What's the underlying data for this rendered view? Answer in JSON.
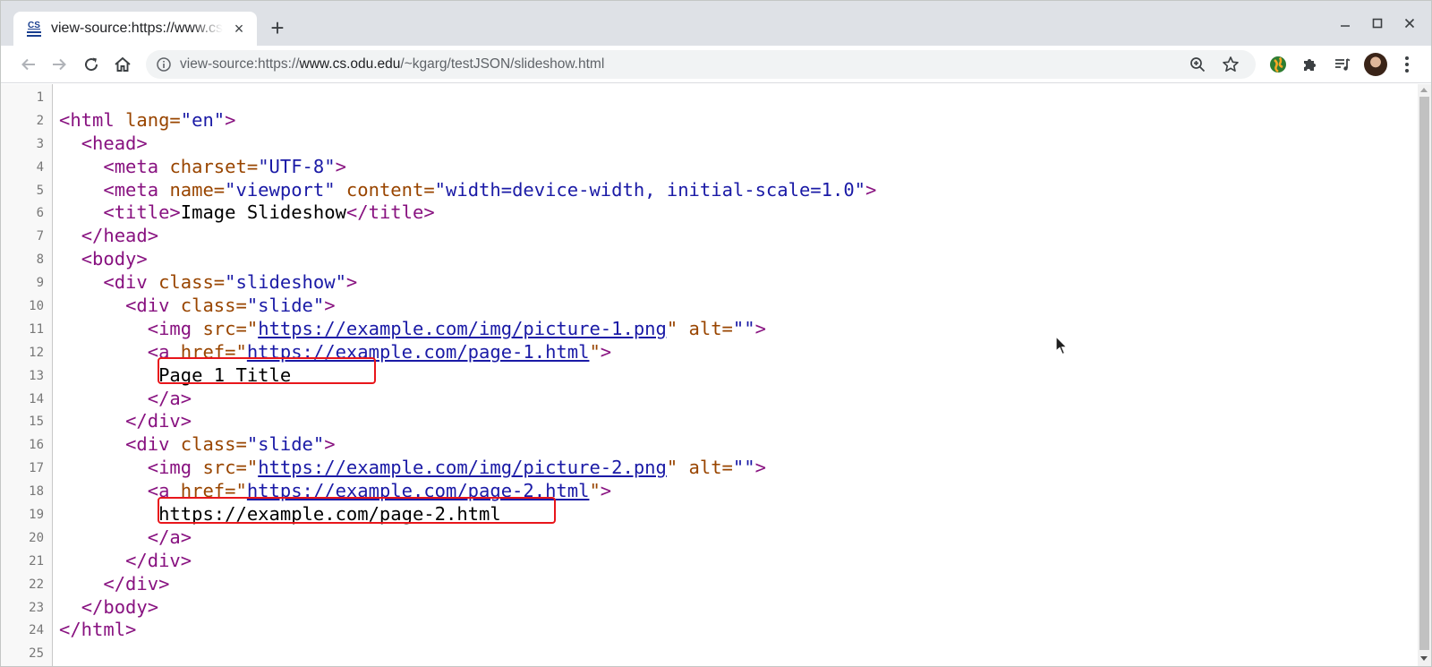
{
  "browser": {
    "tab": {
      "title": "view-source:https://www.cs.odu.edu/~kgarg/testJSON/slideshow.html",
      "favicon_text": "CS"
    },
    "new_tab_symbol": "+",
    "url_scheme": "view-source:https://",
    "url_host": "www.cs.odu.edu",
    "url_path": "/~kgarg/testJSON/slideshow.html"
  },
  "source": {
    "lines": [
      {
        "n": "1"
      },
      {
        "n": "2",
        "t1": "<html ",
        "a1": "lang=",
        "v1": "\"en\"",
        "t2": ">"
      },
      {
        "n": "3",
        "t1": "<head>"
      },
      {
        "n": "4",
        "t1": "<meta ",
        "a1": "charset=",
        "v1": "\"UTF-8\"",
        "t2": ">"
      },
      {
        "n": "5",
        "t1": "<meta ",
        "a1": "name=",
        "v1": "\"viewport\"",
        "a2": " content=",
        "v2": "\"width=device-width, initial-scale=1.0\"",
        "t2": ">"
      },
      {
        "n": "6",
        "t1": "<title>",
        "x1": "Image Slideshow",
        "t2": "</title>"
      },
      {
        "n": "7",
        "t1": "</head>"
      },
      {
        "n": "8",
        "t1": "<body>"
      },
      {
        "n": "9",
        "t1": "<div ",
        "a1": "class=",
        "v1": "\"slideshow\"",
        "t2": ">"
      },
      {
        "n": "10",
        "t1": "<div ",
        "a1": "class=",
        "v1": "\"slide\"",
        "t2": ">"
      },
      {
        "n": "11",
        "t1": "<img ",
        "a1": "src=",
        "q1": "\"",
        "l1": "https://example.com/img/picture-1.png",
        "q2": "\"",
        "a2": " alt=",
        "v2": "\"\"",
        "t2": ">"
      },
      {
        "n": "12",
        "t1": "<a ",
        "a1": "href=",
        "q1": "\"",
        "l1": "https://example.com/page-1.html",
        "q2": "\"",
        "t2": ">"
      },
      {
        "n": "13",
        "x1": "Page 1 Title"
      },
      {
        "n": "14",
        "t1": "</a>"
      },
      {
        "n": "15",
        "t1": "</div>"
      },
      {
        "n": "16",
        "t1": "<div ",
        "a1": "class=",
        "v1": "\"slide\"",
        "t2": ">"
      },
      {
        "n": "17",
        "t1": "<img ",
        "a1": "src=",
        "q1": "\"",
        "l1": "https://example.com/img/picture-2.png",
        "q2": "\"",
        "a2": " alt=",
        "v2": "\"\"",
        "t2": ">"
      },
      {
        "n": "18",
        "t1": "<a ",
        "a1": "href=",
        "q1": "\"",
        "l1": "https://example.com/page-2.html",
        "q2": "\"",
        "t2": ">"
      },
      {
        "n": "19",
        "x1": "https://example.com/page-2.html"
      },
      {
        "n": "20",
        "t1": "</a>"
      },
      {
        "n": "21",
        "t1": "</div>"
      },
      {
        "n": "22",
        "t1": "</div>"
      },
      {
        "n": "23",
        "t1": "</body>"
      },
      {
        "n": "24",
        "t1": "</html>"
      },
      {
        "n": "25"
      }
    ]
  },
  "colors": {
    "tag": "#881280",
    "attribute": "#994500",
    "value": "#1a1aa6",
    "highlight_box": "#e8161b"
  }
}
